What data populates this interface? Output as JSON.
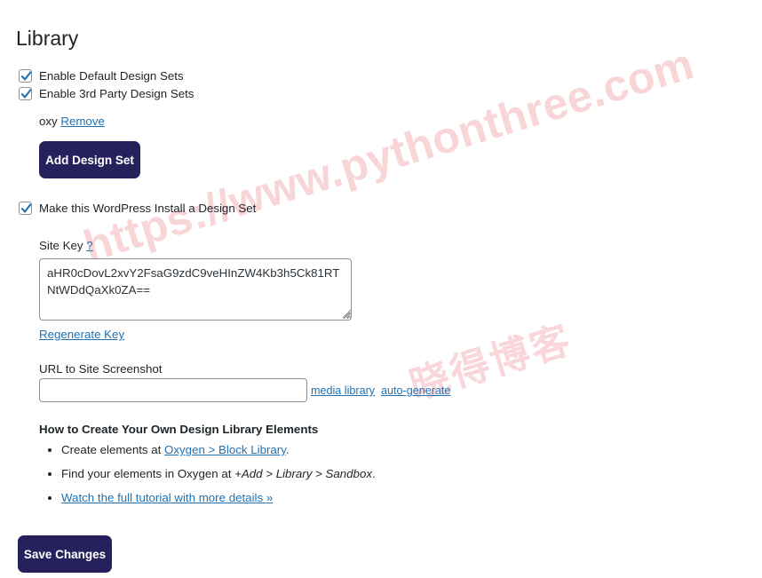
{
  "page": {
    "title": "Library"
  },
  "watermark": {
    "url_text": "https://www.pythonthree.com",
    "cn_text": "晓得博客",
    "color": "#f6c5c9"
  },
  "colors": {
    "accent_button": "#26215c",
    "link": "#2271b1",
    "checkbox_check": "#2271b1",
    "text": "#1d2327",
    "input_border": "#8c8f94"
  },
  "options": {
    "enable_default_design_sets": {
      "label": "Enable Default Design Sets",
      "checked": true
    },
    "enable_3rd_party_design_sets": {
      "label": "Enable 3rd Party Design Sets",
      "checked": true
    },
    "third_party_entry": {
      "name": "oxy",
      "remove_label": "Remove"
    },
    "add_design_set_button": "Add Design Set",
    "make_design_set": {
      "label": "Make this WordPress Install a Design Set",
      "checked": true
    }
  },
  "site_key": {
    "label": "Site Key",
    "help_link": "?",
    "value": "aHR0cDovL2xvY2FsaG9zdC9veHInZW4Kb3h5Ck81RTNtWDdQaXk0ZA==",
    "regenerate_label": "Regenerate Key"
  },
  "screenshot": {
    "label": "URL to Site Screenshot",
    "value": "",
    "placeholder": "",
    "media_library_label": "media library",
    "auto_generate_label": "auto-generate"
  },
  "howto": {
    "title": "How to Create Your Own Design Library Elements",
    "items": [
      {
        "prefix": "Create elements at ",
        "link": "Oxygen > Block Library",
        "suffix": ".",
        "is_link_item": false
      },
      {
        "prefix": "Find your elements in Oxygen at ",
        "emphasis": "+Add > Library > Sandbox",
        "suffix": ".",
        "is_link_item": false
      },
      {
        "link": "Watch the full tutorial with more details »",
        "is_link_item": true
      }
    ]
  },
  "footer": {
    "save_label": "Save Changes"
  }
}
